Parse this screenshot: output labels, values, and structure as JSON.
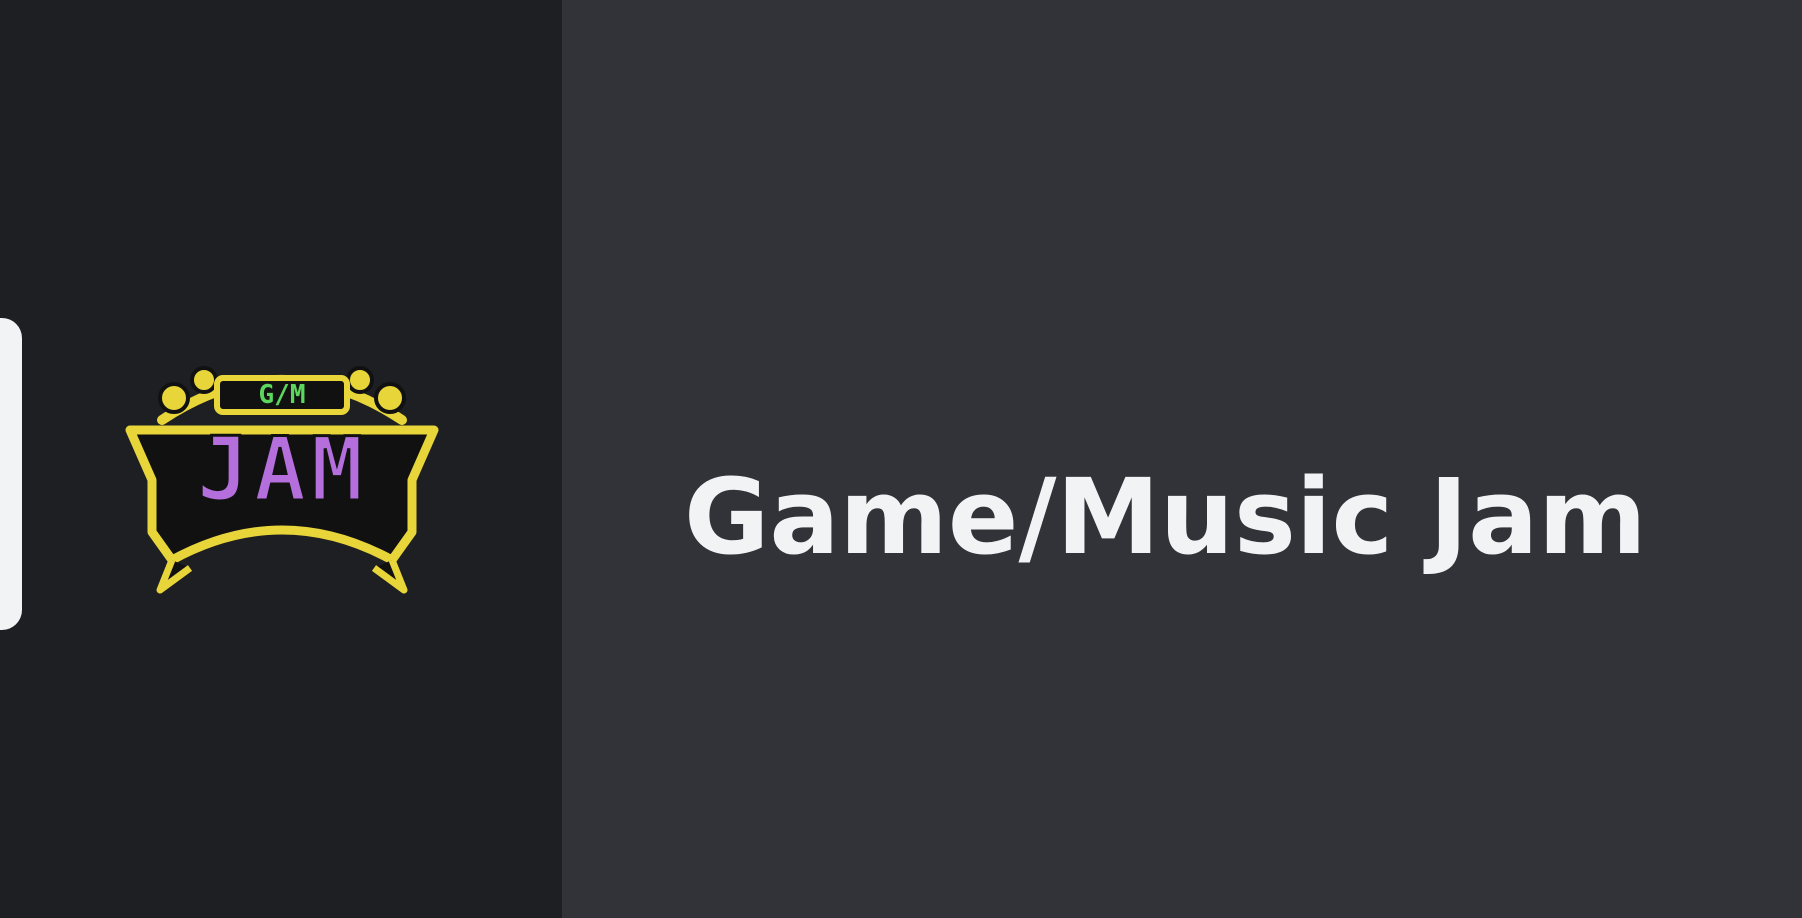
{
  "server_rail": {
    "selected_server": {
      "icon_name": "gm-jam-logo",
      "logo_text_top": "G/M",
      "logo_text_main": "JAM",
      "colors": {
        "outline": "#e7d53a",
        "main_text": "#b46fdc",
        "top_text": "#5cd65c"
      }
    },
    "selection_indicator_color": "#f2f3f5"
  },
  "header": {
    "server_name": "Game/Music Jam"
  },
  "theme": {
    "rail_background": "#1e1f22",
    "main_background": "#313338",
    "text_color": "#f2f3f5"
  }
}
